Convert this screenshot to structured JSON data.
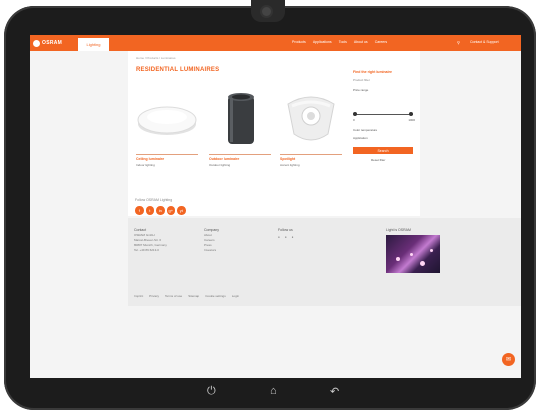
{
  "header": {
    "brand": "OSRAM",
    "active_tab": "Lighting",
    "nav": [
      "Products",
      "Applications",
      "Tools",
      "About us",
      "Careers"
    ],
    "search_icon": "search-icon",
    "contact": "Contact & Support"
  },
  "content": {
    "breadcrumb": "Home / Products / Luminaires",
    "title": "RESIDENTIAL LUMINAIRES",
    "products": [
      {
        "name": "Ceiling luminaire",
        "desc": "Indoor lighting"
      },
      {
        "name": "Outdoor luminaire",
        "desc": "Outdoor lighting"
      },
      {
        "name": "Spotlight",
        "desc": "Accent lighting"
      }
    ],
    "filter": {
      "title": "Find the right luminaire",
      "subtitle": "Product filter",
      "range_label": "Price range",
      "range_min": "0",
      "range_max": "1000",
      "option_label": "Color temperature",
      "option_label2": "Application",
      "button": "Search",
      "reset": "Reset filter"
    }
  },
  "follow": {
    "label": "Follow OSRAM Lighting",
    "networks": [
      "f",
      "t",
      "in",
      "g+",
      "yt"
    ]
  },
  "footer": {
    "col1_head": "Contact",
    "col1": [
      "OSRAM GmbH",
      "Marcel-Breuer-Str. 6",
      "80807 Munich, Germany",
      "Tel. +49 89 6213-0"
    ],
    "col2_head": "Company",
    "col2": [
      "About",
      "Careers",
      "Press",
      "Investors"
    ],
    "col3_head": "Follow us",
    "col4_head": "Light is OSRAM",
    "legal": [
      "Imprint",
      "Privacy",
      "Terms of use",
      "Sitemap",
      "Cookie settings",
      "Login"
    ]
  },
  "system": {
    "power_icon": "power-icon",
    "home_icon": "home-icon",
    "back_icon": "back-icon"
  },
  "colors": {
    "accent": "#f26522",
    "bezel": "#1c1c1c",
    "footer_bg": "#ebebeb"
  }
}
